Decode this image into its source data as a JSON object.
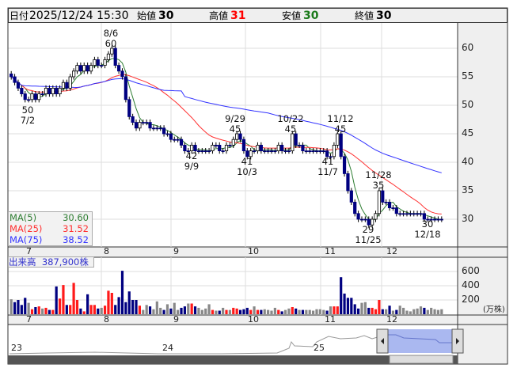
{
  "header": {
    "date_label": "日付",
    "datetime": "2025/12/24 15:30",
    "open_label": "始値",
    "open": "30",
    "high_label": "高値",
    "high": "31",
    "low_label": "安値",
    "low": "30",
    "close_label": "終値",
    "close": "30"
  },
  "colors": {
    "up_volume": "#ff1a1a",
    "down": "#000080",
    "flat": "#888888",
    "ma5": "#2e7d32",
    "ma25": "#ff3030",
    "ma75": "#3333ff",
    "high_text": "#ff0000",
    "low_text": "#1a7a1a"
  },
  "legend": {
    "ma5_label": "MA(5)",
    "ma5": "30.60",
    "ma25_label": "MA(25)",
    "ma25": "31.52",
    "ma75_label": "MA(75)",
    "ma75": "38.52"
  },
  "volume": {
    "label": "出来高",
    "value": "387,900株",
    "unit": "(万株)"
  },
  "annotations": [
    {
      "top": "8/6",
      "bottom": "60"
    },
    {
      "top": "50",
      "bottom": "7/2"
    },
    {
      "top": "9/29",
      "bottom": "45"
    },
    {
      "top": "42",
      "bottom": "9/9"
    },
    {
      "top": "41",
      "bottom": "10/3"
    },
    {
      "top": "10/22",
      "bottom": "45"
    },
    {
      "top": "11/12",
      "bottom": "45"
    },
    {
      "top": "41",
      "bottom": "11/7"
    },
    {
      "top": "11/28",
      "bottom": "35"
    },
    {
      "top": "29",
      "bottom": "11/25"
    },
    {
      "top": "30",
      "bottom": "12/18"
    }
  ],
  "navigator": {
    "labels": [
      "23",
      "24",
      "25"
    ]
  },
  "chart_data": {
    "type": "candlestick",
    "months": [
      "7",
      "8",
      "9",
      "10",
      "11",
      "12"
    ],
    "price_ticks": [
      "60",
      "55",
      "50",
      "45",
      "40",
      "35",
      "30"
    ],
    "price_range": [
      26,
      64
    ],
    "volume_ticks": [
      "600",
      "400",
      "200"
    ],
    "volume_range": [
      0,
      700
    ],
    "closes": [
      55,
      54,
      53,
      52,
      51,
      51,
      52,
      51,
      52,
      52,
      53,
      52,
      53,
      52,
      53,
      54,
      53,
      55,
      56,
      57,
      56,
      57,
      56,
      57,
      58,
      57,
      57,
      58,
      59,
      60,
      57,
      56,
      55,
      51,
      48,
      47,
      46,
      47,
      47,
      47,
      46,
      46,
      46,
      46,
      45,
      45,
      44,
      44,
      44,
      43,
      42,
      42,
      43,
      42,
      42,
      42,
      42,
      42,
      43,
      43,
      42,
      42,
      43,
      43,
      44,
      45,
      44,
      42,
      41,
      42,
      42,
      43,
      42,
      42,
      42,
      42,
      42,
      43,
      42,
      42,
      42,
      45,
      43,
      43,
      42,
      42,
      42,
      42,
      42,
      42,
      42,
      41,
      41,
      43,
      45,
      41,
      38,
      35,
      33,
      31,
      30,
      30,
      30,
      29,
      30,
      31,
      35,
      33,
      33,
      32,
      32,
      31,
      31,
      31,
      31,
      31,
      31,
      31,
      31,
      30,
      30,
      30,
      30,
      30,
      30
    ],
    "volumes": [
      210,
      170,
      200,
      130,
      230,
      160,
      70,
      100,
      110,
      80,
      90,
      60,
      60,
      390,
      220,
      410,
      130,
      130,
      440,
      200,
      80,
      40,
      280,
      130,
      130,
      80,
      90,
      120,
      330,
      300,
      130,
      240,
      610,
      170,
      320,
      200,
      200,
      120,
      60,
      130,
      110,
      70,
      180,
      90,
      60,
      140,
      80,
      160,
      60,
      90,
      110,
      150,
      150,
      110,
      90,
      60,
      80,
      140,
      60,
      50,
      50,
      90,
      60,
      60,
      90,
      80,
      60,
      70,
      90,
      60,
      110,
      60,
      60,
      70,
      60,
      50,
      90,
      60,
      40,
      60,
      80,
      100,
      80,
      60,
      60,
      60,
      60,
      50,
      70,
      70,
      60,
      50,
      110,
      110,
      110,
      520,
      290,
      230,
      230,
      140,
      80,
      160,
      170,
      90,
      90,
      70,
      200,
      70,
      70,
      120,
      50,
      60,
      120,
      90,
      50,
      40,
      70,
      80,
      110,
      90,
      60,
      90,
      70,
      60,
      70
    ]
  }
}
